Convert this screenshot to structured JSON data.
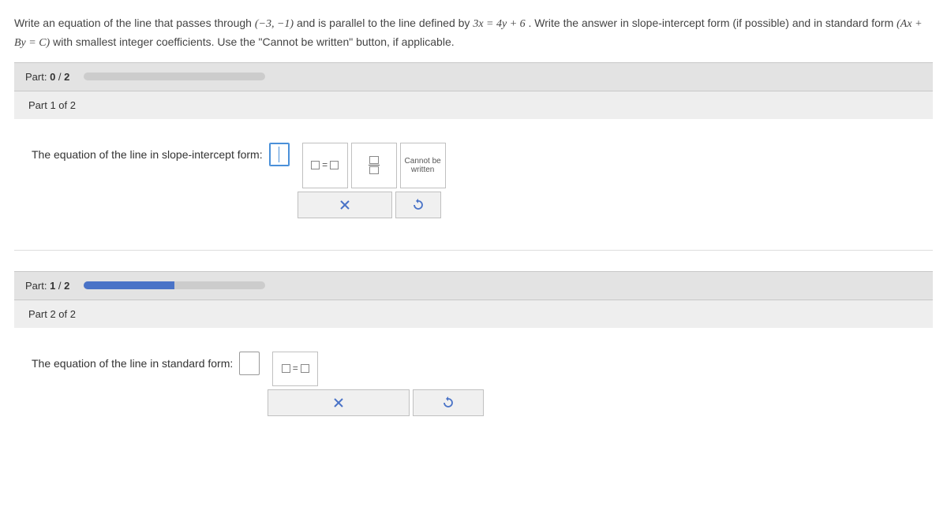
{
  "question": {
    "pre": "Write an equation of the line that passes through ",
    "point": "(−3, −1)",
    "mid1": " and is parallel to the line defined by ",
    "eq": "3x = 4y + 6",
    "mid2": ". Write the answer in slope-intercept form (if possible) and in standard form ",
    "form": "(Ax + By = C)",
    "post": " with smallest integer coefficients. Use the \"Cannot be written\" button, if applicable."
  },
  "parts": {
    "p1": {
      "label_prefix": "Part: ",
      "current": "0",
      "sep": " / ",
      "total": "2",
      "progress_pct": 0
    },
    "p2": {
      "label_prefix": "Part: ",
      "current": "1",
      "sep": " / ",
      "total": "2",
      "progress_pct": 50
    }
  },
  "sub1": {
    "title": "Part 1 of 2",
    "prompt": "The equation of the line in slope-intercept form:"
  },
  "sub2": {
    "title": "Part 2 of 2",
    "prompt": "The equation of the line in standard form:"
  },
  "palette": {
    "eq_template": "□=□",
    "fraction": "fraction",
    "cannot": "Cannot be written",
    "clear": "clear",
    "reset": "reset"
  }
}
